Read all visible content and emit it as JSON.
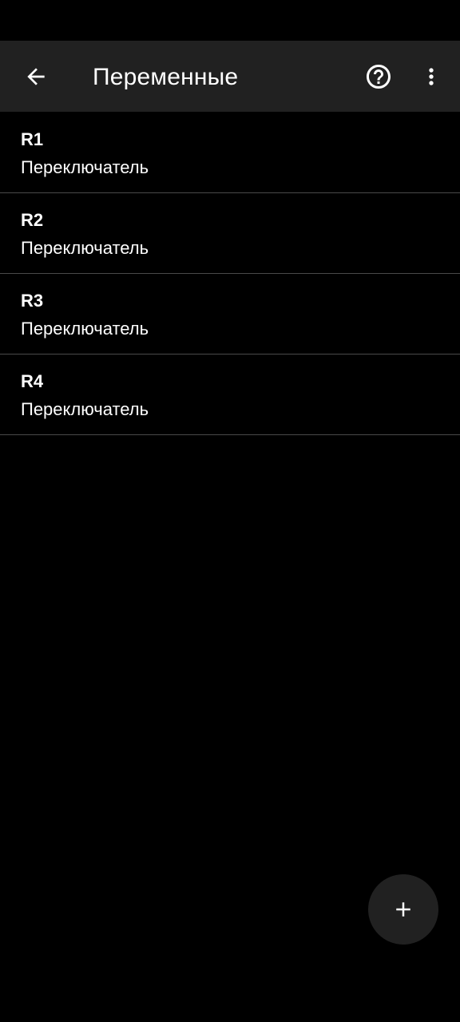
{
  "app_bar": {
    "title": "Переменные",
    "back_icon": "arrow-back-icon",
    "help_icon": "help-circle-icon",
    "more_icon": "more-vert-icon"
  },
  "variables": [
    {
      "name": "R1",
      "type": "Переключатель"
    },
    {
      "name": "R2",
      "type": "Переключатель"
    },
    {
      "name": "R3",
      "type": "Переключатель"
    },
    {
      "name": "R4",
      "type": "Переключатель"
    }
  ],
  "fab": {
    "icon": "add-icon"
  },
  "colors": {
    "background": "#000000",
    "app_bar": "#212121",
    "divider": "#4a4a4a",
    "text": "#ffffff"
  }
}
